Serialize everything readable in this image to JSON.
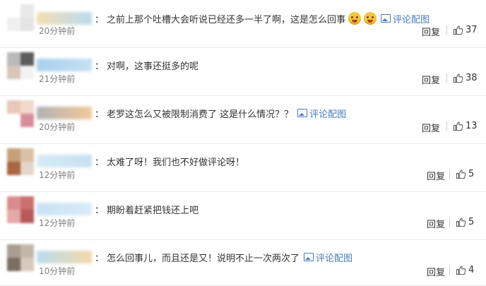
{
  "reply_label": "回复",
  "picture_link_label": "评论配图",
  "colors": {
    "link": "#4a7cb8",
    "time": "#808080",
    "text": "#333333"
  },
  "comments": [
    {
      "username": "",
      "text": "之前上那个吐槽大会听说已经还多一半了啊，这是怎么回事",
      "emojis": 2,
      "has_picture_link": true,
      "time": "20分钟前",
      "likes": "37",
      "name_colors": [
        "#f4dfb2",
        "#b9dcf0"
      ],
      "avatar_colors": [
        "#ffffff",
        "#e8e8e8",
        "#f0f0f0",
        "#e4e4e4"
      ]
    },
    {
      "username": "...烧",
      "text": "对啊，这事还挺多的呢",
      "emojis": 0,
      "has_picture_link": false,
      "time": "21分钟前",
      "likes": "38",
      "name_colors": [
        "#a9d0ee",
        "#c7e0f3"
      ],
      "avatar_colors": [
        "#b9b9b9",
        "#5c5c5c",
        "#d8c6b8",
        "#f2f2f2"
      ]
    },
    {
      "username": "",
      "text": "老罗这怎么又被限制消费了 这是什么情况？？",
      "emojis": 0,
      "has_picture_link": true,
      "time": "20分钟前",
      "likes": "13",
      "name_colors": [
        "#b2b2b2",
        "#f2c99b"
      ],
      "avatar_colors": [
        "#e8c8b8",
        "#f0d9cc",
        "#ffffff",
        "#d88e9a"
      ]
    },
    {
      "username": "",
      "text": "太难了呀！我们也不好做评论呀！",
      "emojis": 0,
      "has_picture_link": false,
      "time": "12分钟前",
      "likes": "5",
      "name_colors": [
        "#d7ebf7",
        "#c6e1f2"
      ],
      "avatar_colors": [
        "#c7a07a",
        "#d9c0a5",
        "#a86642",
        "#e2d6c8"
      ]
    },
    {
      "username": "",
      "text": "期盼着赶紧把钱还上吧",
      "emojis": 0,
      "has_picture_link": false,
      "time": "12分钟前",
      "likes": "5",
      "name_colors": [
        "#c8e2f4",
        "#d9ecf8"
      ],
      "avatar_colors": [
        "#d98c8c",
        "#c97070",
        "#e6a8a8",
        "#b65a5a"
      ]
    },
    {
      "username": "",
      "text": "怎么回事儿，而且还是又！说明不止一次两次了",
      "emojis": 0,
      "has_picture_link": true,
      "time": "10分钟前",
      "likes": "4",
      "name_colors": [
        "#b9dcf0",
        "#f4d9a8"
      ],
      "avatar_colors": [
        "#a99c90",
        "#c4b6a8",
        "#7d6e62",
        "#d6cabd"
      ]
    }
  ]
}
